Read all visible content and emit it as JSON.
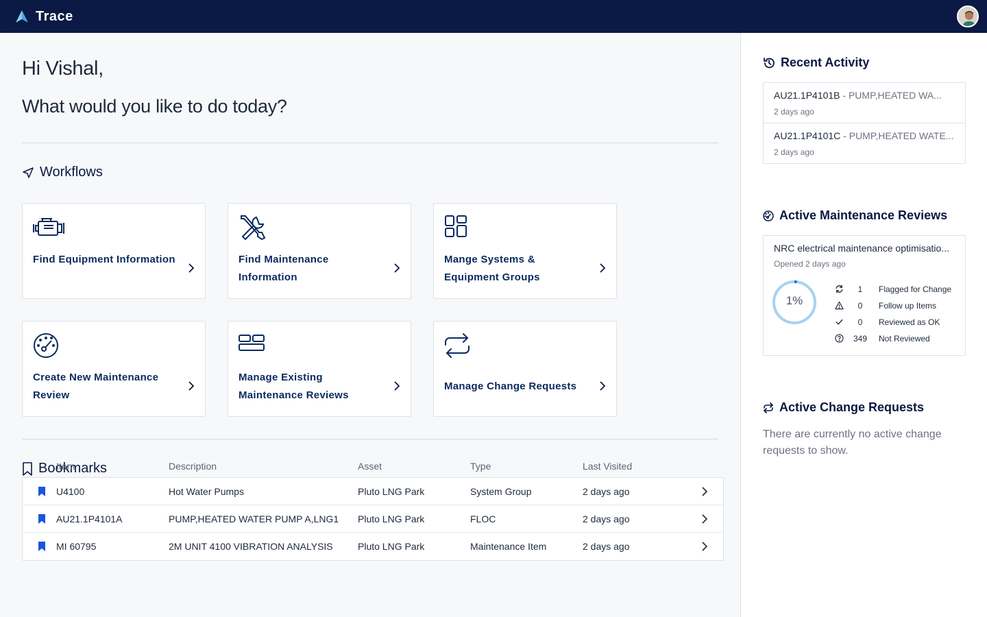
{
  "app": {
    "name": "Trace"
  },
  "greeting": "Hi Vishal,",
  "question": "What would you like to do today?",
  "workflows": {
    "title": "Workflows",
    "cards": [
      {
        "label": "Find Equipment Information",
        "icon": "engine-icon"
      },
      {
        "label": "Find Maintenance Information",
        "icon": "tools-icon"
      },
      {
        "label": "Mange Systems & Equipment Groups",
        "icon": "grid-icon"
      },
      {
        "label": "Create New Maintenance Review",
        "icon": "gauge-icon"
      },
      {
        "label": "Manage Existing Maintenance Reviews",
        "icon": "layout-icon"
      },
      {
        "label": "Manage Change Requests",
        "icon": "swap-icon"
      }
    ]
  },
  "bookmarks": {
    "title": "Bookmarks",
    "columns": [
      "Item",
      "Description",
      "Asset",
      "Type",
      "Last Visited"
    ],
    "rows": [
      {
        "item": "U4100",
        "description": "Hot Water Pumps",
        "asset": "Pluto LNG Park",
        "type": "System Group",
        "last_visited": "2 days ago"
      },
      {
        "item": "AU21.1P4101A",
        "description": "PUMP,HEATED WATER PUMP A,LNG1",
        "asset": "Pluto LNG Park",
        "type": "FLOC",
        "last_visited": "2 days ago"
      },
      {
        "item": "MI 60795",
        "description": "2M UNIT 4100 VIBRATION ANALYSIS",
        "asset": "Pluto LNG Park",
        "type": "Maintenance Item",
        "last_visited": "2 days ago"
      }
    ]
  },
  "recent_activity": {
    "title": "Recent Activity",
    "items": [
      {
        "code": "AU21.1P4101B",
        "description": " - PUMP,HEATED WA...",
        "time": "2 days ago"
      },
      {
        "code": "AU21.1P4101C",
        "description": " - PUMP,HEATED WATE...",
        "time": "2 days ago"
      }
    ]
  },
  "active_reviews": {
    "title": "Active Maintenance Reviews",
    "review": {
      "name": "NRC electrical maintenance optimisatio...",
      "opened": "Opened 2 days ago",
      "progress_label": "1%",
      "progress_fraction": 0.01,
      "stats": [
        {
          "icon": "refresh-icon",
          "count": "1",
          "label": "Flagged for Change"
        },
        {
          "icon": "warning-icon",
          "count": "0",
          "label": "Follow up Items"
        },
        {
          "icon": "check-icon",
          "count": "0",
          "label": "Reviewed as OK"
        },
        {
          "icon": "question-icon",
          "count": "349",
          "label": "Not Reviewed"
        }
      ]
    }
  },
  "active_change_requests": {
    "title": "Active Change Requests",
    "empty_text": "There are currently no active change requests to show."
  },
  "colors": {
    "navy": "#0a1a44",
    "accent_blue": "#1a56db",
    "ring": "#a9d2ee"
  }
}
